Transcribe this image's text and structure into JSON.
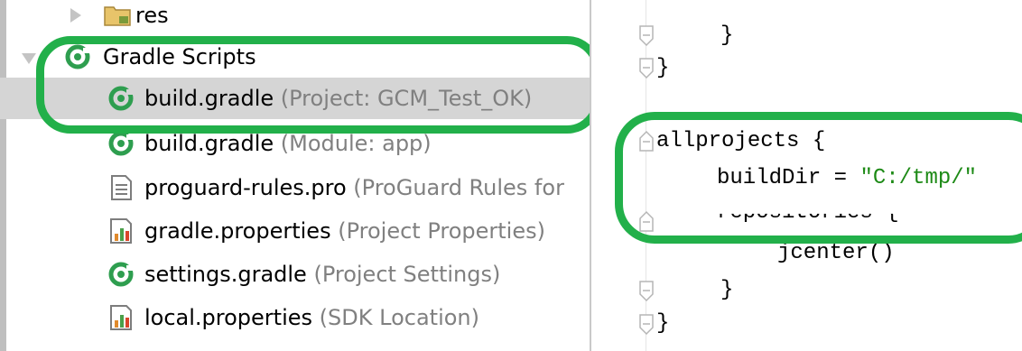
{
  "project_tree": {
    "items": [
      {
        "icon": "folder-icon",
        "name": "res",
        "hint": "",
        "arrow": "collapsed"
      },
      {
        "icon": "gradle-icon",
        "name": "Gradle Scripts",
        "hint": "",
        "arrow": "expanded"
      },
      {
        "icon": "gradle-icon",
        "name": "build.gradle",
        "hint": "(Project: GCM_Test_OK)",
        "selected": true
      },
      {
        "icon": "gradle-icon",
        "name": "build.gradle",
        "hint": "(Module: app)"
      },
      {
        "icon": "text-file-icon",
        "name": "proguard-rules.pro",
        "hint": "(ProGuard Rules for"
      },
      {
        "icon": "properties-file-icon",
        "name": "gradle.properties",
        "hint": "(Project Properties)"
      },
      {
        "icon": "gradle-icon",
        "name": "settings.gradle",
        "hint": "(Project Settings)"
      },
      {
        "icon": "properties-file-icon",
        "name": "local.properties",
        "hint": "(SDK Location)"
      }
    ]
  },
  "editor": {
    "lines": {
      "l1": "}",
      "l2": "}",
      "l3": "allprojects {",
      "l4_key": "buildDir = ",
      "l4_val": "\"C:/tmp/\"",
      "l5": "repositories {",
      "l6": "jcenter()",
      "l7": "}",
      "l8": "}"
    }
  },
  "colors": {
    "annotation": "#22b04a",
    "gradle_icon": "#2e9e4f",
    "selection": "#d5d5d5",
    "hint_text": "#808080",
    "string_literal": "#1d8a16"
  }
}
